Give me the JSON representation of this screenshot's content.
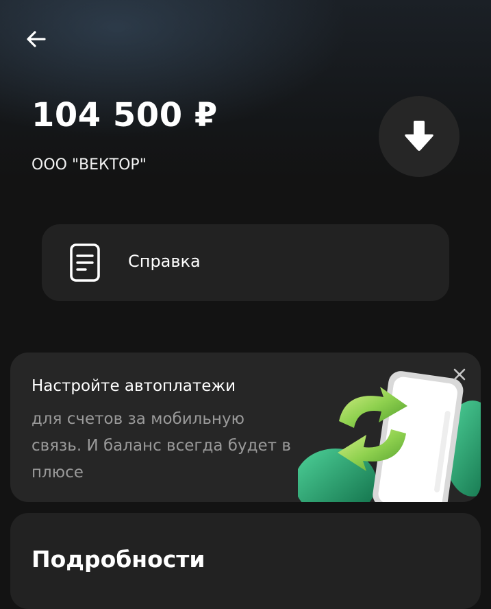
{
  "header": {
    "back_icon": "arrow-left-icon"
  },
  "payment": {
    "amount": "104 500 ₽",
    "payee": "ООО \"ВЕКТОР\"",
    "download_icon": "download-arrow-icon"
  },
  "info_button": {
    "label": "Справка",
    "icon": "document-icon"
  },
  "promo": {
    "title": "Настройте автоплатежи",
    "text": "для счетов за мобильную связь. И баланс всегда будет в плюсе",
    "close_icon": "close-icon",
    "image_icon": "phone-refresh-illustration"
  },
  "details": {
    "heading": "Подробности"
  },
  "colors": {
    "background": "#131313",
    "card": "#222222",
    "promo_card": "#262626",
    "muted_text": "#9a9a9a",
    "accent_green": "#8fd14f"
  }
}
